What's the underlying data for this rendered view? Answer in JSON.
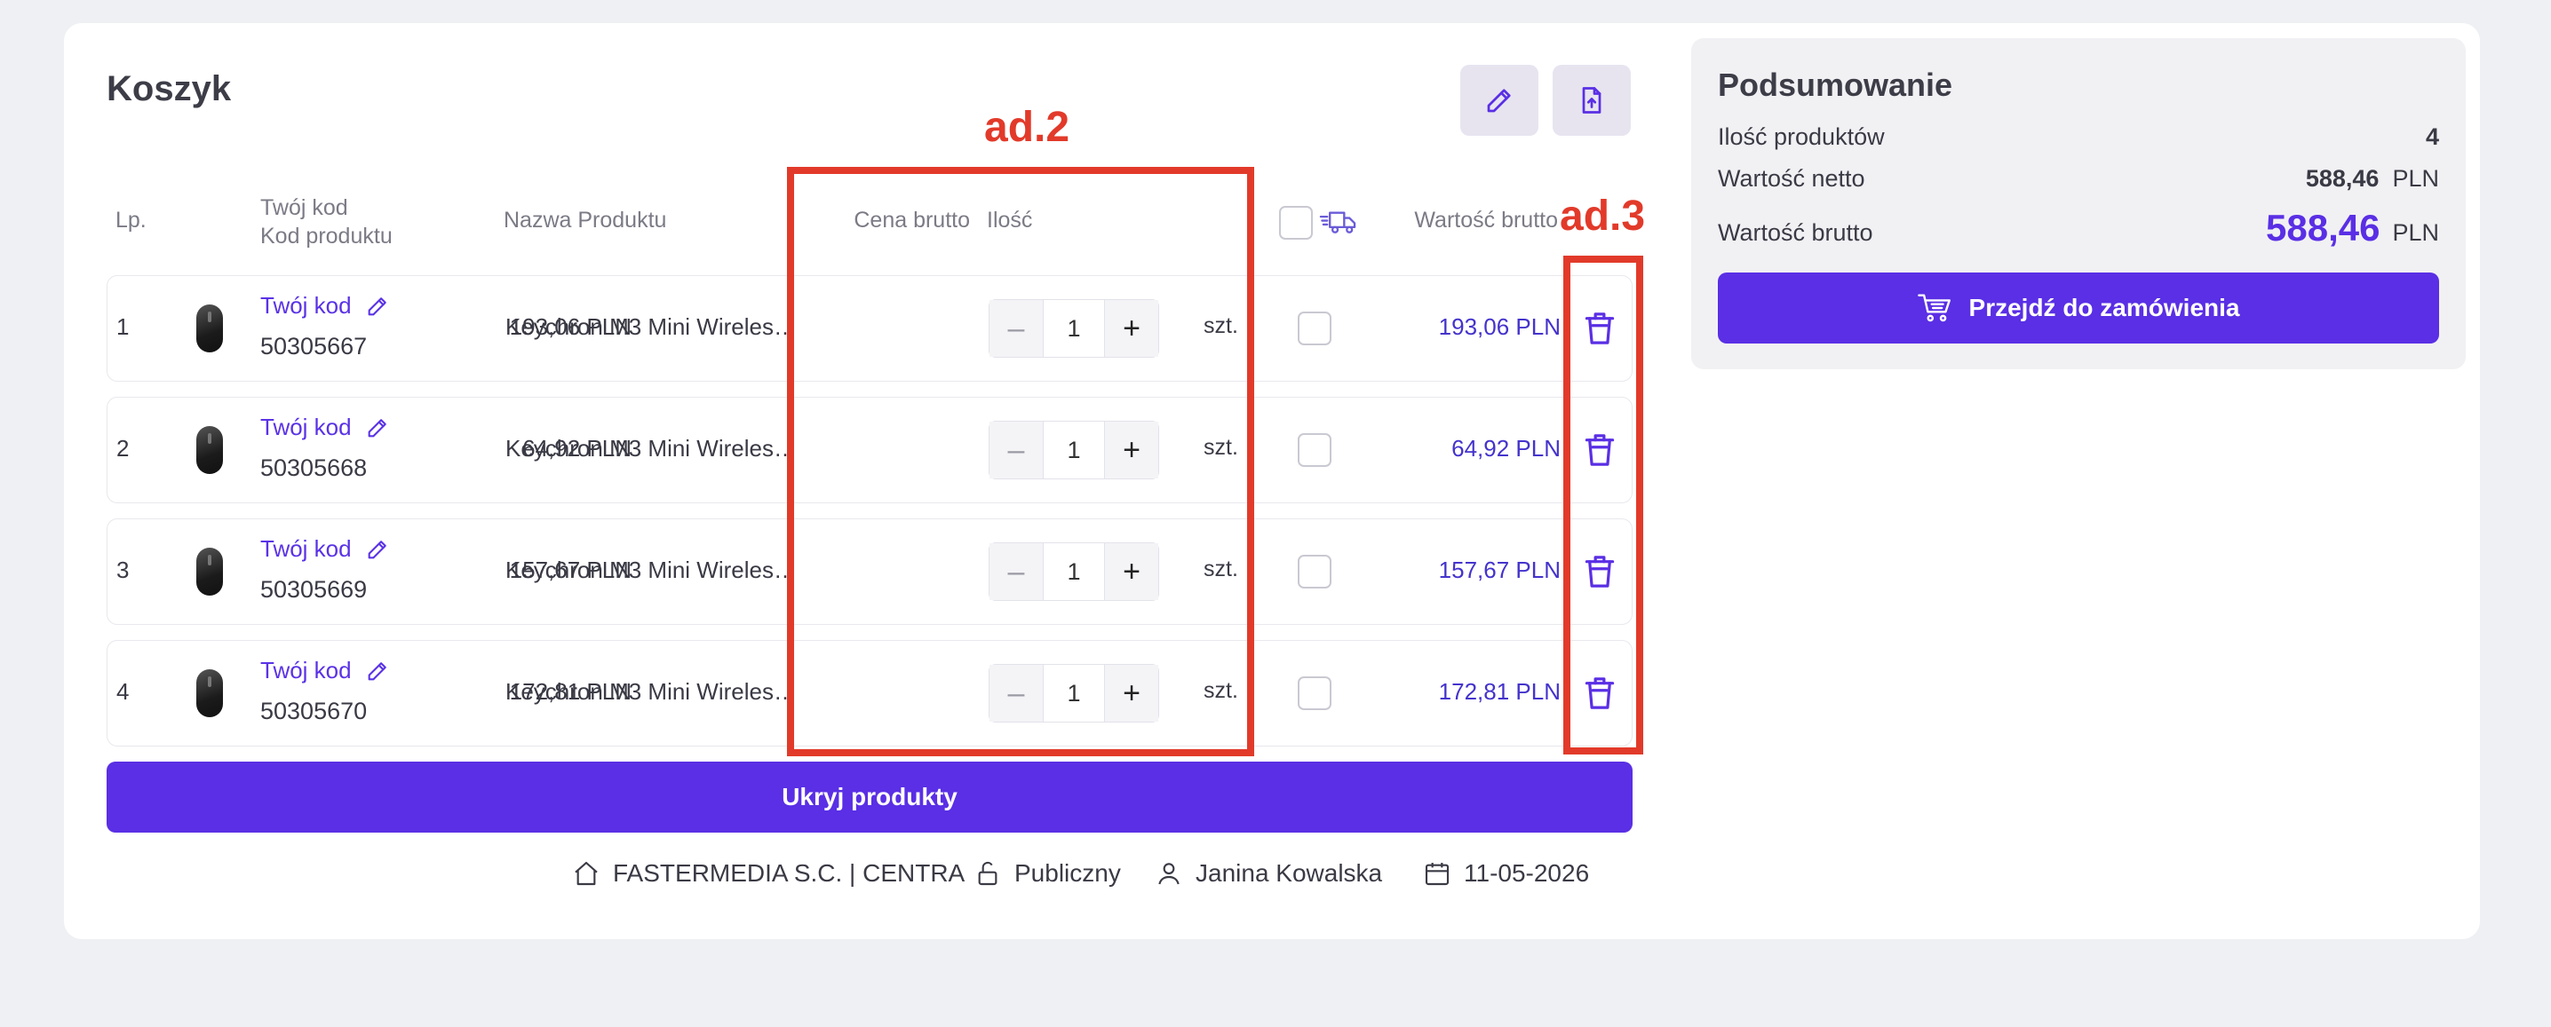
{
  "cart": {
    "title": "Koszyk",
    "headers": {
      "lp": "Lp.",
      "your_code": "Twój kod",
      "product_code": "Kod produktu",
      "product_name": "Nazwa Produktu",
      "gross_price": "Cena brutto",
      "quantity": "Ilość",
      "gross_value": "Wartość brutto"
    },
    "rows": [
      {
        "lp": "1",
        "code_link": "Twój kod",
        "code": "50305667",
        "name": "Keychron M3 Mini Wireless ...",
        "price": "193,06 PLN",
        "qty": "1",
        "unit": "szt.",
        "gross": "193,06 PLN"
      },
      {
        "lp": "2",
        "code_link": "Twój kod",
        "code": "50305668",
        "name": "Keychron M3 Mini Wireless ...",
        "price": "64,92 PLN",
        "qty": "1",
        "unit": "szt.",
        "gross": "64,92 PLN"
      },
      {
        "lp": "3",
        "code_link": "Twój kod",
        "code": "50305669",
        "name": "Keychron M3 Mini Wireless ...",
        "price": "157,67 PLN",
        "qty": "1",
        "unit": "szt.",
        "gross": "157,67 PLN"
      },
      {
        "lp": "4",
        "code_link": "Twój kod",
        "code": "50305670",
        "name": "Keychron M3 Mini Wireless ...",
        "price": "172,81 PLN",
        "qty": "1",
        "unit": "szt.",
        "gross": "172,81 PLN"
      }
    ],
    "hide_button": "Ukryj produkty",
    "step_minus": "–",
    "step_plus": "+"
  },
  "meta": {
    "company": "FASTERMEDIA S.C. | CENTRA",
    "visibility": "Publiczny",
    "user": "Janina Kowalska",
    "date": "11-05-2026"
  },
  "summary": {
    "title": "Podsumowanie",
    "count_label": "Ilość produktów",
    "count_value": "4",
    "net_label": "Wartość netto",
    "net_value": "588,46",
    "net_currency": "PLN",
    "gross_label": "Wartość brutto",
    "gross_value": "588,46",
    "gross_currency": "PLN",
    "order_button": "Przejdź do zamówienia"
  },
  "annotations": {
    "label_2": "ad.2",
    "label_3": "ad.3"
  },
  "icons": {
    "edit": "pencil-icon",
    "export": "file-upload-icon",
    "delivery": "truck-icon",
    "delete": "trash-icon",
    "cart": "cart-icon",
    "home": "home-icon",
    "lock": "unlock-icon",
    "user": "user-icon",
    "calendar": "calendar-icon"
  },
  "colors": {
    "accent": "#5a2fe5",
    "link": "#5a32e6",
    "annotation": "#e23a2a"
  }
}
